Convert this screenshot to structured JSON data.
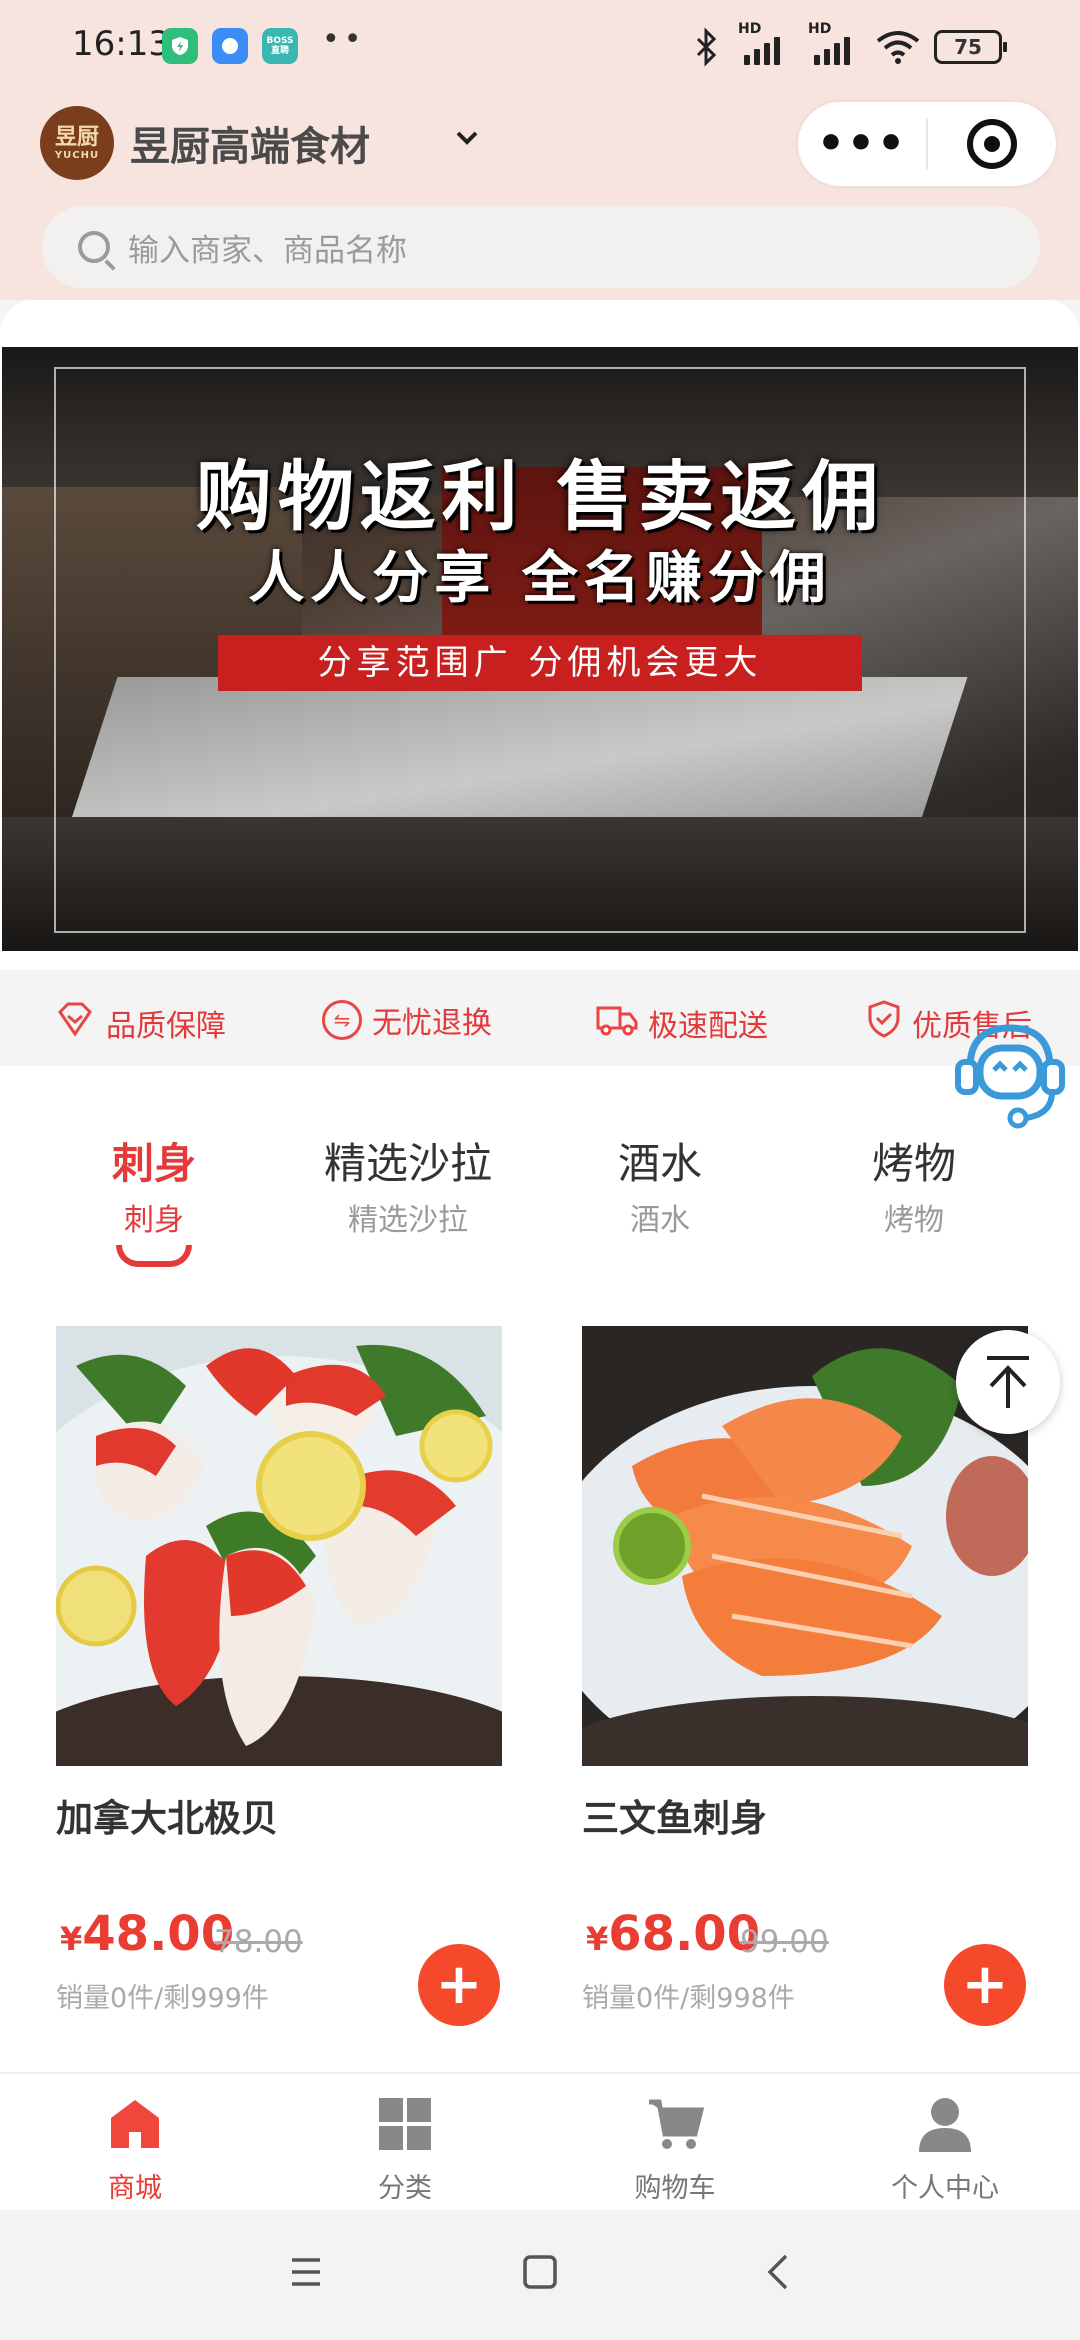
{
  "status_bar": {
    "time": "16:13",
    "app_icons": [
      {
        "icon": "shield-app-icon",
        "color": "#2fbf7a",
        "label": ""
      },
      {
        "icon": "chat-app-icon",
        "color": "#3a8df5",
        "label": ""
      },
      {
        "icon": "boss-app-icon",
        "color": "#3ab7b1",
        "label": "BOSS直聘"
      }
    ],
    "more": "••",
    "signal_labels": [
      "HD",
      "HD"
    ],
    "battery": "75"
  },
  "header": {
    "logo_text": "昱厨",
    "logo_sub": "YUCHU",
    "title": "昱厨高端食材",
    "capsule_more": "•••"
  },
  "search": {
    "placeholder": "输入商家、商品名称"
  },
  "banner": {
    "headline": "购物返利 售卖返佣",
    "subline": "人人分享 全名赚分佣",
    "tagline": "分享范围广 分佣机会更大"
  },
  "guarantees": [
    {
      "icon": "diamond-icon",
      "label": "品质保障"
    },
    {
      "icon": "exchange-icon",
      "label": "无忧退换"
    },
    {
      "icon": "truck-icon",
      "label": "极速配送"
    },
    {
      "icon": "shield-check-icon",
      "label": "优质售后"
    }
  ],
  "categories": [
    {
      "name": "刺身",
      "sub": "刺身",
      "active": true
    },
    {
      "name": "精选沙拉",
      "sub": "精选沙拉",
      "active": false
    },
    {
      "name": "酒水",
      "sub": "酒水",
      "active": false
    },
    {
      "name": "烤物",
      "sub": "烤物",
      "active": false
    }
  ],
  "products": [
    {
      "name": "加拿大北极贝",
      "currency": "¥",
      "price": "48.00",
      "old_price": "78.00",
      "sales": "销量0件/剩999件",
      "add": "+"
    },
    {
      "name": "三文鱼刺身",
      "currency": "¥",
      "price": "68.00",
      "old_price": "99.00",
      "sales": "销量0件/剩998件",
      "add": "+"
    }
  ],
  "tabbar": [
    {
      "icon": "home-icon",
      "label": "商城",
      "active": true
    },
    {
      "icon": "grid-icon",
      "label": "分类",
      "active": false
    },
    {
      "icon": "cart-icon",
      "label": "购物车",
      "active": false
    },
    {
      "icon": "user-icon",
      "label": "个人中心",
      "active": false
    }
  ],
  "colors": {
    "accent": "#e93c33",
    "header_bg": "#f7e4df",
    "add_button": "#f4492b",
    "support_icon": "#3a9ad9"
  }
}
